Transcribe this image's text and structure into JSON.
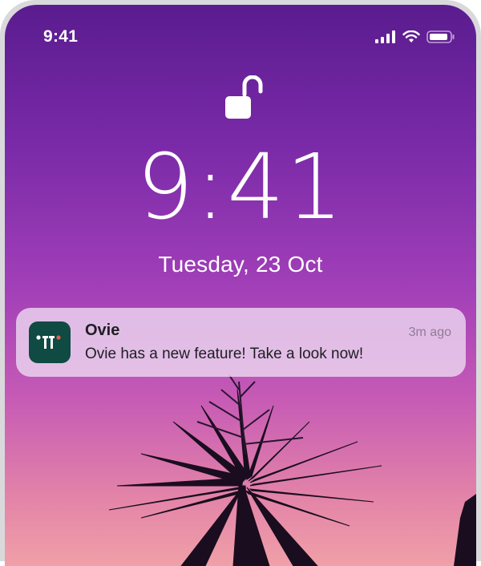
{
  "status_bar": {
    "time": "9:41",
    "icons": [
      "cellular-signal-icon",
      "wifi-icon",
      "battery-icon"
    ]
  },
  "lock_screen": {
    "lock_icon": "unlocked-padlock-icon",
    "time": "9:41",
    "date": "Tuesday, 23 Oct"
  },
  "notification": {
    "app_name": "Ovie",
    "time_ago": "3m ago",
    "message": "Ovie has a new feature! Take a look now!",
    "app_icon": "ovie-app-icon",
    "icon_color": "#0f4a43",
    "accent_color": "#e85a4f"
  },
  "colors": {
    "wallpaper_top": "#5a1c8f",
    "wallpaper_bottom": "#f0a0a8"
  }
}
